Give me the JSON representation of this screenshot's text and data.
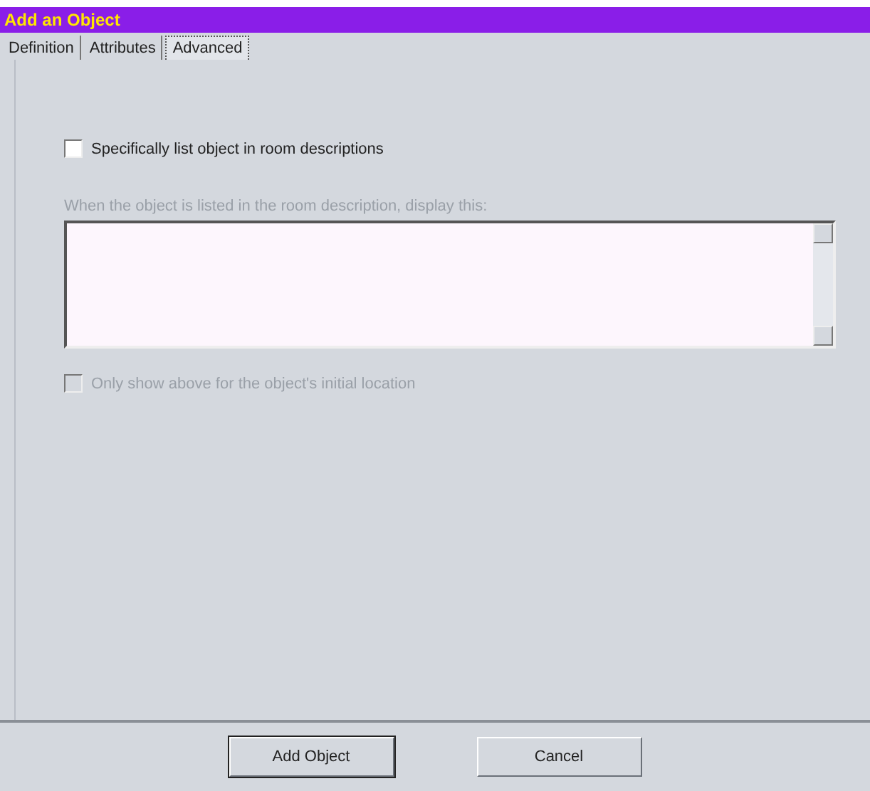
{
  "window": {
    "title": "Add an Object"
  },
  "tabs": [
    {
      "label": "Definition",
      "selected": false
    },
    {
      "label": "Attributes",
      "selected": false
    },
    {
      "label": "Advanced",
      "selected": true
    }
  ],
  "list_checkbox": {
    "label": "Specifically list object in room descriptions",
    "checked": false,
    "disabled": false
  },
  "description": {
    "label": "When the object is listed in the room description, display this:",
    "disabled": true
  },
  "initial_checkbox": {
    "label": "Only show above for the object's initial location",
    "checked": false,
    "disabled": true
  },
  "buttons": [
    {
      "label": "Add Object",
      "default": true
    },
    {
      "label": "Cancel",
      "default": false
    }
  ]
}
